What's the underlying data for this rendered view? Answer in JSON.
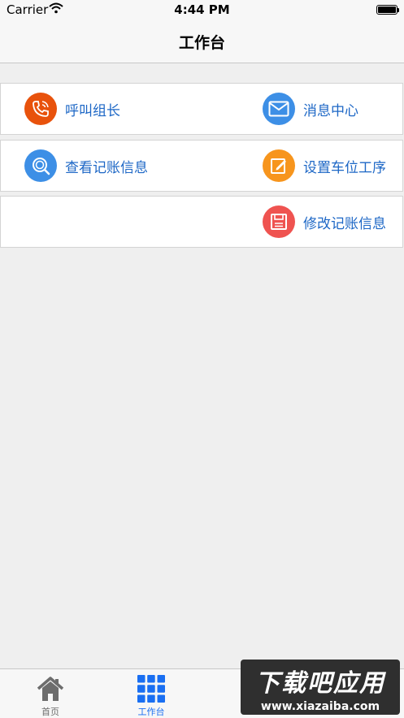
{
  "status_bar": {
    "carrier": "Carrier",
    "time": "4:44 PM"
  },
  "nav": {
    "title": "工作台"
  },
  "menu": {
    "call_leader": {
      "label": "呼叫组长",
      "icon": "phone-icon",
      "color": "#e8520c"
    },
    "message_center": {
      "label": "消息中心",
      "icon": "mail-icon",
      "color": "#3d8fe6"
    },
    "view_records": {
      "label": "查看记账信息",
      "icon": "search-icon",
      "color": "#3d8fe6"
    },
    "set_process": {
      "label": "设置车位工序",
      "icon": "edit-icon",
      "color": "#f7951d"
    },
    "modify_records": {
      "label": "修改记账信息",
      "icon": "save-icon",
      "color": "#ef5350"
    }
  },
  "tabbar": {
    "tabs": [
      {
        "label": "首页",
        "icon": "home-icon",
        "active": false
      },
      {
        "label": "工作台",
        "icon": "grid-icon",
        "active": true
      }
    ]
  },
  "watermark": {
    "title": "下载吧应用",
    "url": "www.xiazaiba.com"
  },
  "colors": {
    "label_blue": "#1d67c6",
    "tab_active": "#1a6ff2",
    "tab_inactive": "#6d6d6d",
    "background": "#efefef"
  }
}
